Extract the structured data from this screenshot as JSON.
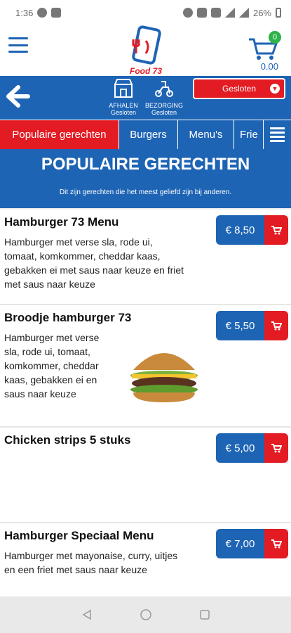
{
  "status_bar": {
    "time": "1:36",
    "battery": "26%"
  },
  "header": {
    "logo_text": "Food 73",
    "cart_count": "0",
    "cart_total": "0.00"
  },
  "services": {
    "takeaway_label": "AFHALEN",
    "takeaway_status": "Gesloten",
    "delivery_label": "BEZORGING",
    "delivery_status": "Gesloten",
    "select_value": "Gesloten"
  },
  "tabs": [
    {
      "label": "Populaire gerechten"
    },
    {
      "label": "Burgers"
    },
    {
      "label": "Menu's"
    },
    {
      "label": "Frie"
    }
  ],
  "hero": {
    "title": "POPULAIRE GERECHTEN",
    "subtitle": "Dit zijn gerechten die het meest geliefd zijn bij anderen."
  },
  "items": [
    {
      "name": "Hamburger 73 Menu",
      "desc_lines": [
        "Hamburger met verse sla, rode ui,",
        "tomaat, komkommer, cheddar kaas,",
        "gebakken ei met saus naar keuze en friet",
        "met saus naar keuze"
      ],
      "price": "€ 8,50"
    },
    {
      "name": "Broodje hamburger 73",
      "desc_lines": [
        "Hamburger met verse",
        "sla, rode ui, tomaat,",
        "komkommer, cheddar",
        "kaas, gebakken ei en",
        "saus naar keuze"
      ],
      "price": "€ 5,50"
    },
    {
      "name": "Chicken strips 5 stuks",
      "desc_lines": [],
      "price": "€ 5,00"
    },
    {
      "name": "Hamburger Speciaal Menu",
      "desc_lines": [
        "Hamburger met mayonaise, curry, uitjes",
        "en een friet met saus naar keuze"
      ],
      "price": "€ 7,00"
    }
  ],
  "colors": {
    "brand_blue": "#1e64b4",
    "brand_red": "#e31b23",
    "cart_badge": "#2db34a"
  }
}
